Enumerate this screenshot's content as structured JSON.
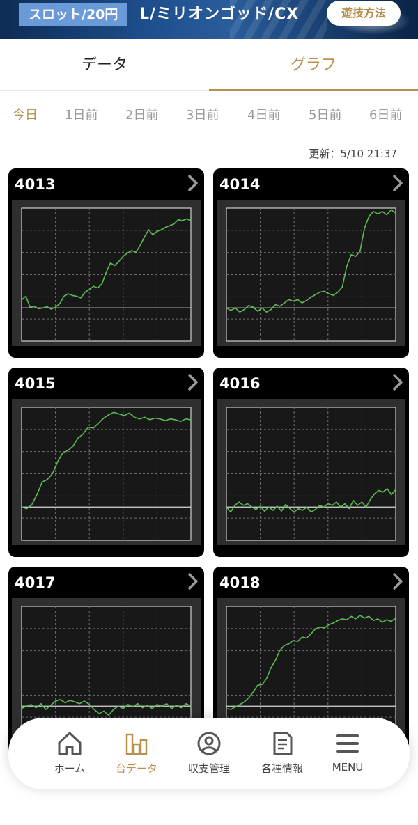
{
  "header": {
    "type_badge": "スロット/20円",
    "machine_title": "L/ミリオンゴッド/CX",
    "howto_label": "遊技方法"
  },
  "tabs": [
    {
      "label": "データ",
      "active": false
    },
    {
      "label": "グラフ",
      "active": true
    }
  ],
  "days": [
    {
      "label": "今日",
      "active": true
    },
    {
      "label": "1日前",
      "active": false
    },
    {
      "label": "2日前",
      "active": false
    },
    {
      "label": "3日前",
      "active": false
    },
    {
      "label": "4日前",
      "active": false
    },
    {
      "label": "5日前",
      "active": false
    },
    {
      "label": "6日前",
      "active": false
    }
  ],
  "updated_text": "更新：5/10 21:37",
  "machines": [
    {
      "number": "4013"
    },
    {
      "number": "4014"
    },
    {
      "number": "4015"
    },
    {
      "number": "4016"
    },
    {
      "number": "4017"
    },
    {
      "number": "4018"
    }
  ],
  "chart_data": [
    {
      "type": "line",
      "machine": "4013",
      "series": [
        {
          "values": [
            0.95,
            1.4,
            0.1,
            0.2,
            -0.1,
            0.0,
            0.15,
            -0.15,
            0.1,
            0.5,
            1.4,
            1.7,
            1.5,
            1.4,
            1.2,
            1.9,
            2.2,
            2.6,
            2.4,
            2.9,
            4.3,
            5.4,
            5.1,
            5.6,
            6.2,
            6.6,
            6.9,
            6.7,
            7.5,
            8.5,
            9.4,
            8.8,
            9.2,
            9.4,
            9.7,
            9.9,
            10.1,
            10.6,
            10.5,
            10.7,
            10.5
          ]
        }
      ]
    },
    {
      "type": "line",
      "machine": "4014",
      "series": [
        {
          "values": [
            0.0,
            -0.3,
            0.0,
            -0.5,
            -0.2,
            0.3,
            0.1,
            -0.4,
            0.0,
            -0.5,
            -0.2,
            0.4,
            0.2,
            0.6,
            1.0,
            0.8,
            1.0,
            0.6,
            0.9,
            1.3,
            1.6,
            1.9,
            2.0,
            1.7,
            1.5,
            1.9,
            2.5,
            5.0,
            6.4,
            6.2,
            6.8,
            9.6,
            11.0,
            11.6,
            11.3,
            11.6,
            11.2,
            11.8,
            11.4
          ]
        }
      ]
    },
    {
      "type": "line",
      "machine": "4015",
      "series": [
        {
          "values": [
            0.0,
            -0.2,
            0.3,
            1.5,
            3.0,
            3.3,
            4.0,
            5.4,
            6.5,
            6.8,
            7.3,
            8.3,
            8.8,
            9.6,
            9.5,
            10.1,
            10.7,
            11.1,
            11.4,
            11.2,
            11.0,
            11.3,
            10.8,
            10.6,
            10.8,
            10.5,
            10.7,
            10.6,
            10.4,
            10.6,
            10.5,
            10.3,
            10.6,
            10.5
          ]
        }
      ]
    },
    {
      "type": "line",
      "machine": "4016",
      "series": [
        {
          "values": [
            0.0,
            -0.6,
            0.2,
            0.6,
            0.2,
            0.4,
            0.0,
            -0.3,
            0.1,
            -0.5,
            0.0,
            -0.4,
            0.1,
            -0.5,
            0.3,
            -0.2,
            -0.6,
            -0.2,
            -0.4,
            0.0,
            -0.6,
            -0.3,
            0.2,
            0.0,
            0.4,
            0.2,
            0.6,
            0.0,
            0.4,
            -0.2,
            0.8,
            0.2,
            0.6,
            0.0,
            0.9,
            1.6,
            2.0,
            1.8,
            2.2,
            1.5,
            2.1
          ]
        }
      ]
    },
    {
      "type": "line",
      "machine": "4017",
      "series": [
        {
          "values": [
            -0.3,
            0.0,
            0.2,
            -0.2,
            0.3,
            -0.4,
            0.1,
            0.6,
            0.8,
            0.4,
            0.7,
            0.5,
            0.3,
            0.6,
            0.2,
            -0.4,
            -0.9,
            -0.6,
            -1.1,
            -0.4,
            0.0,
            -0.3,
            0.2,
            -0.1,
            0.3,
            -0.2,
            0.1,
            -0.3,
            0.2,
            0.0,
            0.3,
            -0.3,
            0.1,
            -0.2,
            0.3,
            0.0
          ]
        }
      ]
    },
    {
      "type": "line",
      "machine": "4018",
      "series": [
        {
          "values": [
            -0.3,
            -0.4,
            -0.1,
            0.2,
            0.5,
            1.0,
            1.7,
            2.5,
            2.6,
            3.3,
            4.6,
            5.5,
            6.7,
            7.3,
            7.5,
            7.9,
            7.8,
            8.3,
            8.2,
            8.7,
            9.3,
            9.5,
            9.4,
            9.8,
            10.0,
            10.3,
            10.5,
            10.4,
            10.8,
            10.5,
            10.9,
            10.6,
            10.8,
            10.3,
            10.5,
            10.1,
            10.4,
            10.2,
            10.6
          ]
        }
      ]
    }
  ],
  "nav": [
    {
      "label": "ホーム",
      "icon": "home-icon",
      "active": false
    },
    {
      "label": "台データ",
      "icon": "bar-chart-icon",
      "active": true
    },
    {
      "label": "収支管理",
      "icon": "user-circle-icon",
      "active": false
    },
    {
      "label": "各種情報",
      "icon": "document-icon",
      "active": false
    },
    {
      "label": "MENU",
      "icon": "hamburger-icon",
      "active": false
    }
  ],
  "colors": {
    "accent": "#b8914f",
    "graph_line": "#5dbb54",
    "graph_bg": "#2f2f2f",
    "card_bg": "#000000"
  }
}
